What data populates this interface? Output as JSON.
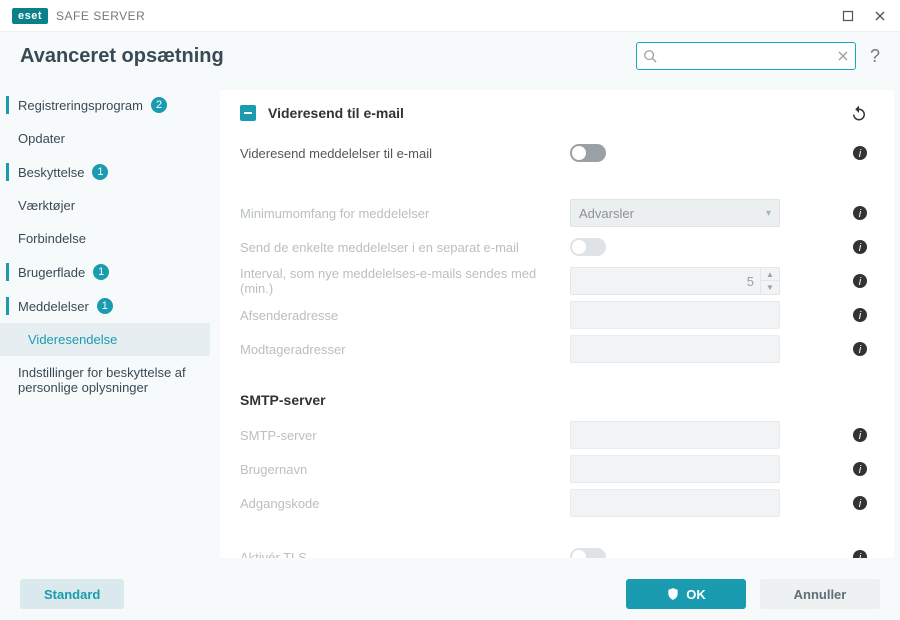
{
  "titlebar": {
    "brand": "eset",
    "product": "SAFE SERVER"
  },
  "header": {
    "title": "Avanceret opsætning",
    "search_placeholder": ""
  },
  "sidebar": {
    "items": [
      {
        "label": "Registreringsprogram",
        "badge": "2"
      },
      {
        "label": "Opdater"
      },
      {
        "label": "Beskyttelse",
        "badge": "1"
      },
      {
        "label": "Værktøjer"
      },
      {
        "label": "Forbindelse"
      },
      {
        "label": "Brugerflade",
        "badge": "1"
      },
      {
        "label": "Meddelelser",
        "badge": "1"
      },
      {
        "label": "Videresendelse"
      },
      {
        "label": "Indstillinger for beskyttelse af personlige oplysninger"
      }
    ]
  },
  "panel": {
    "section_title": "Videresend til e-mail",
    "rows": {
      "forward_label": "Videresend meddelelser til e-mail",
      "min_verbosity_label": "Minimumomfang for meddelelser",
      "min_verbosity_value": "Advarsler",
      "separate_email_label": "Send de enkelte meddelelser i en separat e-mail",
      "interval_label": "Interval, som nye meddelelses-e-mails sendes med (min.)",
      "interval_value": "5",
      "sender_label": "Afsenderadresse",
      "recipient_label": "Modtageradresser"
    },
    "smtp": {
      "title": "SMTP-server",
      "server_label": "SMTP-server",
      "user_label": "Brugernavn",
      "password_label": "Adgangskode",
      "tls_label": "Aktivér TLS"
    }
  },
  "footer": {
    "default": "Standard",
    "ok": "OK",
    "cancel": "Annuller"
  }
}
